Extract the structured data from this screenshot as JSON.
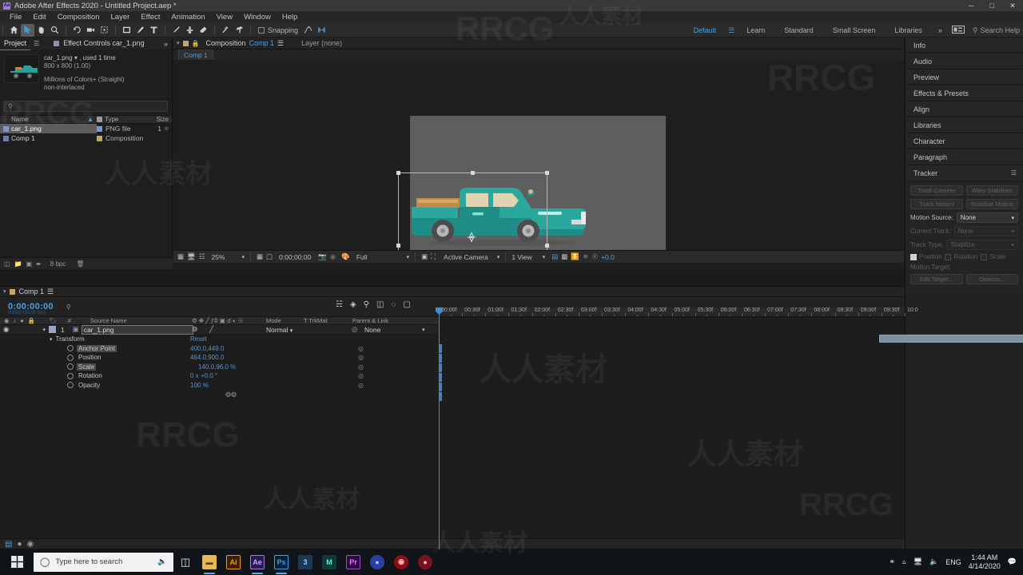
{
  "window": {
    "title": "Adobe After Effects 2020 - Untitled Project.aep *",
    "app_badge": "Ae",
    "minimize": "─",
    "maximize": "□",
    "close": "✕"
  },
  "menubar": [
    "File",
    "Edit",
    "Composition",
    "Layer",
    "Effect",
    "Animation",
    "View",
    "Window",
    "Help"
  ],
  "toolbar": {
    "tools": [
      {
        "name": "home-icon",
        "glyph": "⌂"
      },
      {
        "name": "selection-tool-icon",
        "glyph": "➤"
      },
      {
        "name": "hand-tool-icon",
        "glyph": "✋"
      },
      {
        "name": "zoom-tool-icon",
        "glyph": "⚲"
      },
      {
        "name": "rotation-tool-icon",
        "glyph": "↺"
      },
      {
        "name": "camera-tool-icon",
        "glyph": "▬"
      },
      {
        "name": "pan-behind-tool-icon",
        "glyph": "⌗"
      },
      {
        "name": "shape-tool-icon",
        "glyph": "□"
      },
      {
        "name": "pen-tool-icon",
        "glyph": "✐"
      },
      {
        "name": "type-tool-icon",
        "glyph": "T"
      },
      {
        "name": "brush-tool-icon",
        "glyph": "╱"
      },
      {
        "name": "clone-stamp-tool-icon",
        "glyph": "⊥"
      },
      {
        "name": "eraser-tool-icon",
        "glyph": "◆"
      },
      {
        "name": "roto-brush-tool-icon",
        "glyph": "⫽"
      },
      {
        "name": "puppet-pin-tool-icon",
        "glyph": "✦"
      }
    ],
    "snapping_label": "Snapping",
    "snapping_checked": false
  },
  "workspaces": {
    "items": [
      "Default",
      "Learn",
      "Standard",
      "Small Screen",
      "Libraries"
    ],
    "selected": "Default",
    "overflow": "»",
    "search_placeholder": "Search Help"
  },
  "project": {
    "tabs": [
      {
        "label": "Project",
        "active": true
      },
      {
        "label": "Effect Controls car_1.png",
        "active": false
      }
    ],
    "overflow": "»",
    "preview": {
      "filename": "car_1.png",
      "used": ", used 1 time",
      "dimensions": "800 x 800 (1.00)",
      "color": "Millions of Colors+ (Straight)",
      "interlace": "non-interlaced"
    },
    "search_placeholder": "",
    "columns": {
      "name": "Name",
      "type": "Type",
      "size": "Size"
    },
    "rows": [
      {
        "name": "car_1.png",
        "type": "PNG file",
        "size": "1",
        "selected": true,
        "swatch": "#7f98c8"
      },
      {
        "name": "Comp 1",
        "type": "Composition",
        "size": "",
        "selected": false,
        "swatch": "#c2a86a"
      }
    ],
    "footer": {
      "bit_depth": "8 bpc"
    }
  },
  "composition": {
    "tab_prefix": "Composition",
    "tab_name": "Comp 1",
    "layer_tab": "Layer (none)",
    "sub_tab": "Comp 1",
    "toolbar": {
      "magnification": "25%",
      "timecode": "0:00;00;00",
      "resolution": "Full",
      "camera": "Active Camera",
      "views": "1 View",
      "exposure": "+0.0"
    }
  },
  "sidebar": {
    "panels": [
      "Info",
      "Audio",
      "Preview",
      "Effects & Presets",
      "Align",
      "Libraries",
      "Character",
      "Paragraph"
    ],
    "tracker": {
      "title": "Tracker",
      "buttons": [
        "Track Camera",
        "Warp Stabilizer",
        "Track Motion",
        "Stabilize Motion"
      ],
      "motion_source_label": "Motion Source:",
      "motion_source_value": "None",
      "current_track_label": "Current Track:",
      "current_track_value": "None",
      "track_type_label": "Track Type:",
      "track_type_value": "Stabilize",
      "checkboxes": [
        {
          "label": "Position",
          "checked": true
        },
        {
          "label": "Rotation",
          "checked": false
        },
        {
          "label": "Scale",
          "checked": false
        }
      ],
      "motion_target_label": "Motion Target:",
      "edit_target": "Edit Target...",
      "options": "Options..."
    }
  },
  "timeline": {
    "tab_label": "Comp 1",
    "timecode": "0:00:00:00",
    "timecode_sub": "00000 (30.00 fps)",
    "columns": {
      "source_name": "Source Name",
      "mode": "Mode",
      "trkmat": "T  TrkMat",
      "parent": "Parent & Link",
      "index": "#"
    },
    "layer": {
      "index": "1",
      "name": "car_1.png",
      "mode": "Normal",
      "parent": "None"
    },
    "transform": {
      "group_label": "Transform",
      "reset_label": "Reset",
      "properties": [
        {
          "name": "Anchor Point",
          "value": "400.0,449.0",
          "highlighted": true
        },
        {
          "name": "Position",
          "value": "464.0,900.0",
          "highlighted": false
        },
        {
          "name": "Scale",
          "value": "140.0,96.0 %",
          "highlighted": true
        },
        {
          "name": "Rotation",
          "value": "0 x +0.0 °",
          "highlighted": false
        },
        {
          "name": "Opacity",
          "value": "100 %",
          "highlighted": false
        }
      ]
    },
    "ruler_ticks": [
      "00:00f",
      "00:30f",
      "01:00f",
      "01:30f",
      "02:00f",
      "02:30f",
      "03:00f",
      "03:30f",
      "04:00f",
      "04:30f",
      "05:00f",
      "05:30f",
      "06:00f",
      "06:30f",
      "07:00f",
      "07:30f",
      "08:00f",
      "08:30f",
      "09:00f",
      "09:30f",
      "10:0"
    ]
  },
  "taskbar": {
    "search_placeholder": "Type here to search",
    "apps": [
      {
        "name": "task-view-icon",
        "label": "⌗",
        "bg": "transparent",
        "fg": "#e8e8e8"
      },
      {
        "name": "file-explorer-icon",
        "label": "▬",
        "bg": "#e8b852",
        "fg": "#5b4412"
      },
      {
        "name": "illustrator-icon",
        "label": "Ai",
        "bg": "#3a1f05",
        "fg": "#ff9a00"
      },
      {
        "name": "after-effects-icon",
        "label": "Ae",
        "bg": "#2a1a50",
        "fg": "#c6a0ff"
      },
      {
        "name": "photoshop-icon",
        "label": "Ps",
        "bg": "#041e2e",
        "fg": "#31a8ff"
      },
      {
        "name": "cinema4d-icon",
        "label": "3",
        "bg": "#1b3a52",
        "fg": "#7fd7ff"
      },
      {
        "name": "media-encoder-icon",
        "label": "M",
        "bg": "#0d3b3b",
        "fg": "#67e8d0"
      },
      {
        "name": "premiere-icon",
        "label": "Pr",
        "bg": "#2a0a3d",
        "fg": "#ea77ff"
      },
      {
        "name": "browser-icon",
        "label": "●",
        "bg": "#2a3f9e",
        "fg": "#9fc6ff"
      },
      {
        "name": "recorder-icon",
        "label": "◉",
        "bg": "#8a1111",
        "fg": "#ffb3b3"
      },
      {
        "name": "app-icon",
        "label": "A",
        "bg": "#7a1020",
        "fg": "#ffc0c8"
      }
    ],
    "language": "ENG",
    "time": "1:44 AM",
    "date": "4/14/2020"
  },
  "watermarks": [
    "RRCG",
    "人人素材"
  ]
}
